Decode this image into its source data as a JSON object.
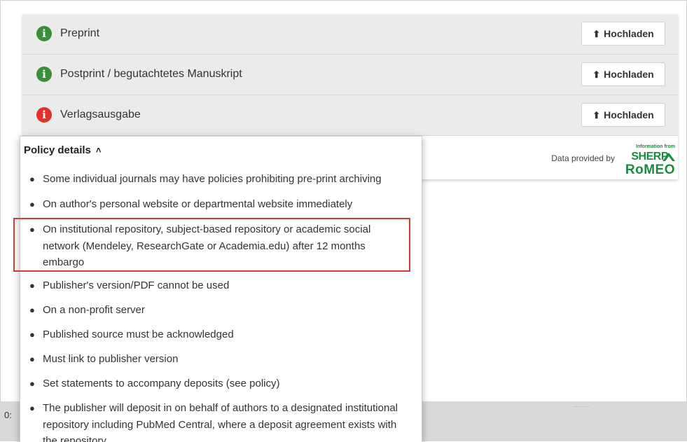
{
  "versions": [
    {
      "label": "Preprint",
      "icon": "info-icon",
      "status_color": "#3a8f3a",
      "button_label": "Hochladen"
    },
    {
      "label": "Postprint / begutachtetes Manuskript",
      "icon": "info-icon",
      "status_color": "#3a8f3a",
      "button_label": "Hochladen"
    },
    {
      "label": "Verlagsausgabe",
      "icon": "info-icon",
      "status_color": "#e0322a",
      "button_label": "Hochladen"
    }
  ],
  "icon_glyph": "i",
  "upload_glyph": "⬆",
  "footer": {
    "data_provided_text": "Data provided by",
    "logo_caption": "Information from",
    "logo_line1": "SHERP",
    "logo_line2": "RoMEO"
  },
  "policy": {
    "header": "Policy details",
    "caret": "^",
    "items": [
      "Some individual journals may have policies prohibiting pre-print archiving",
      "On author's personal website or departmental website immediately",
      "On institutional repository, subject-based repository or academic social network (Mendeley, ResearchGate or Academia.edu) after 12 months embargo",
      "Publisher's version/PDF cannot be used",
      "On a non-profit server",
      "Published source must be acknowledged",
      "Must link to publisher version",
      "Set statements to accompany deposits (see policy)",
      "The publisher will deposit in on behalf of authors to a designated institutional repository including PubMed Central, where a deposit agreement exists with the repository"
    ],
    "highlighted_item_index": 2
  },
  "background_strip": {
    "text": "0:"
  },
  "colors": {
    "highlight": "#d83a3a",
    "logo_green": "#1a8c3e"
  }
}
